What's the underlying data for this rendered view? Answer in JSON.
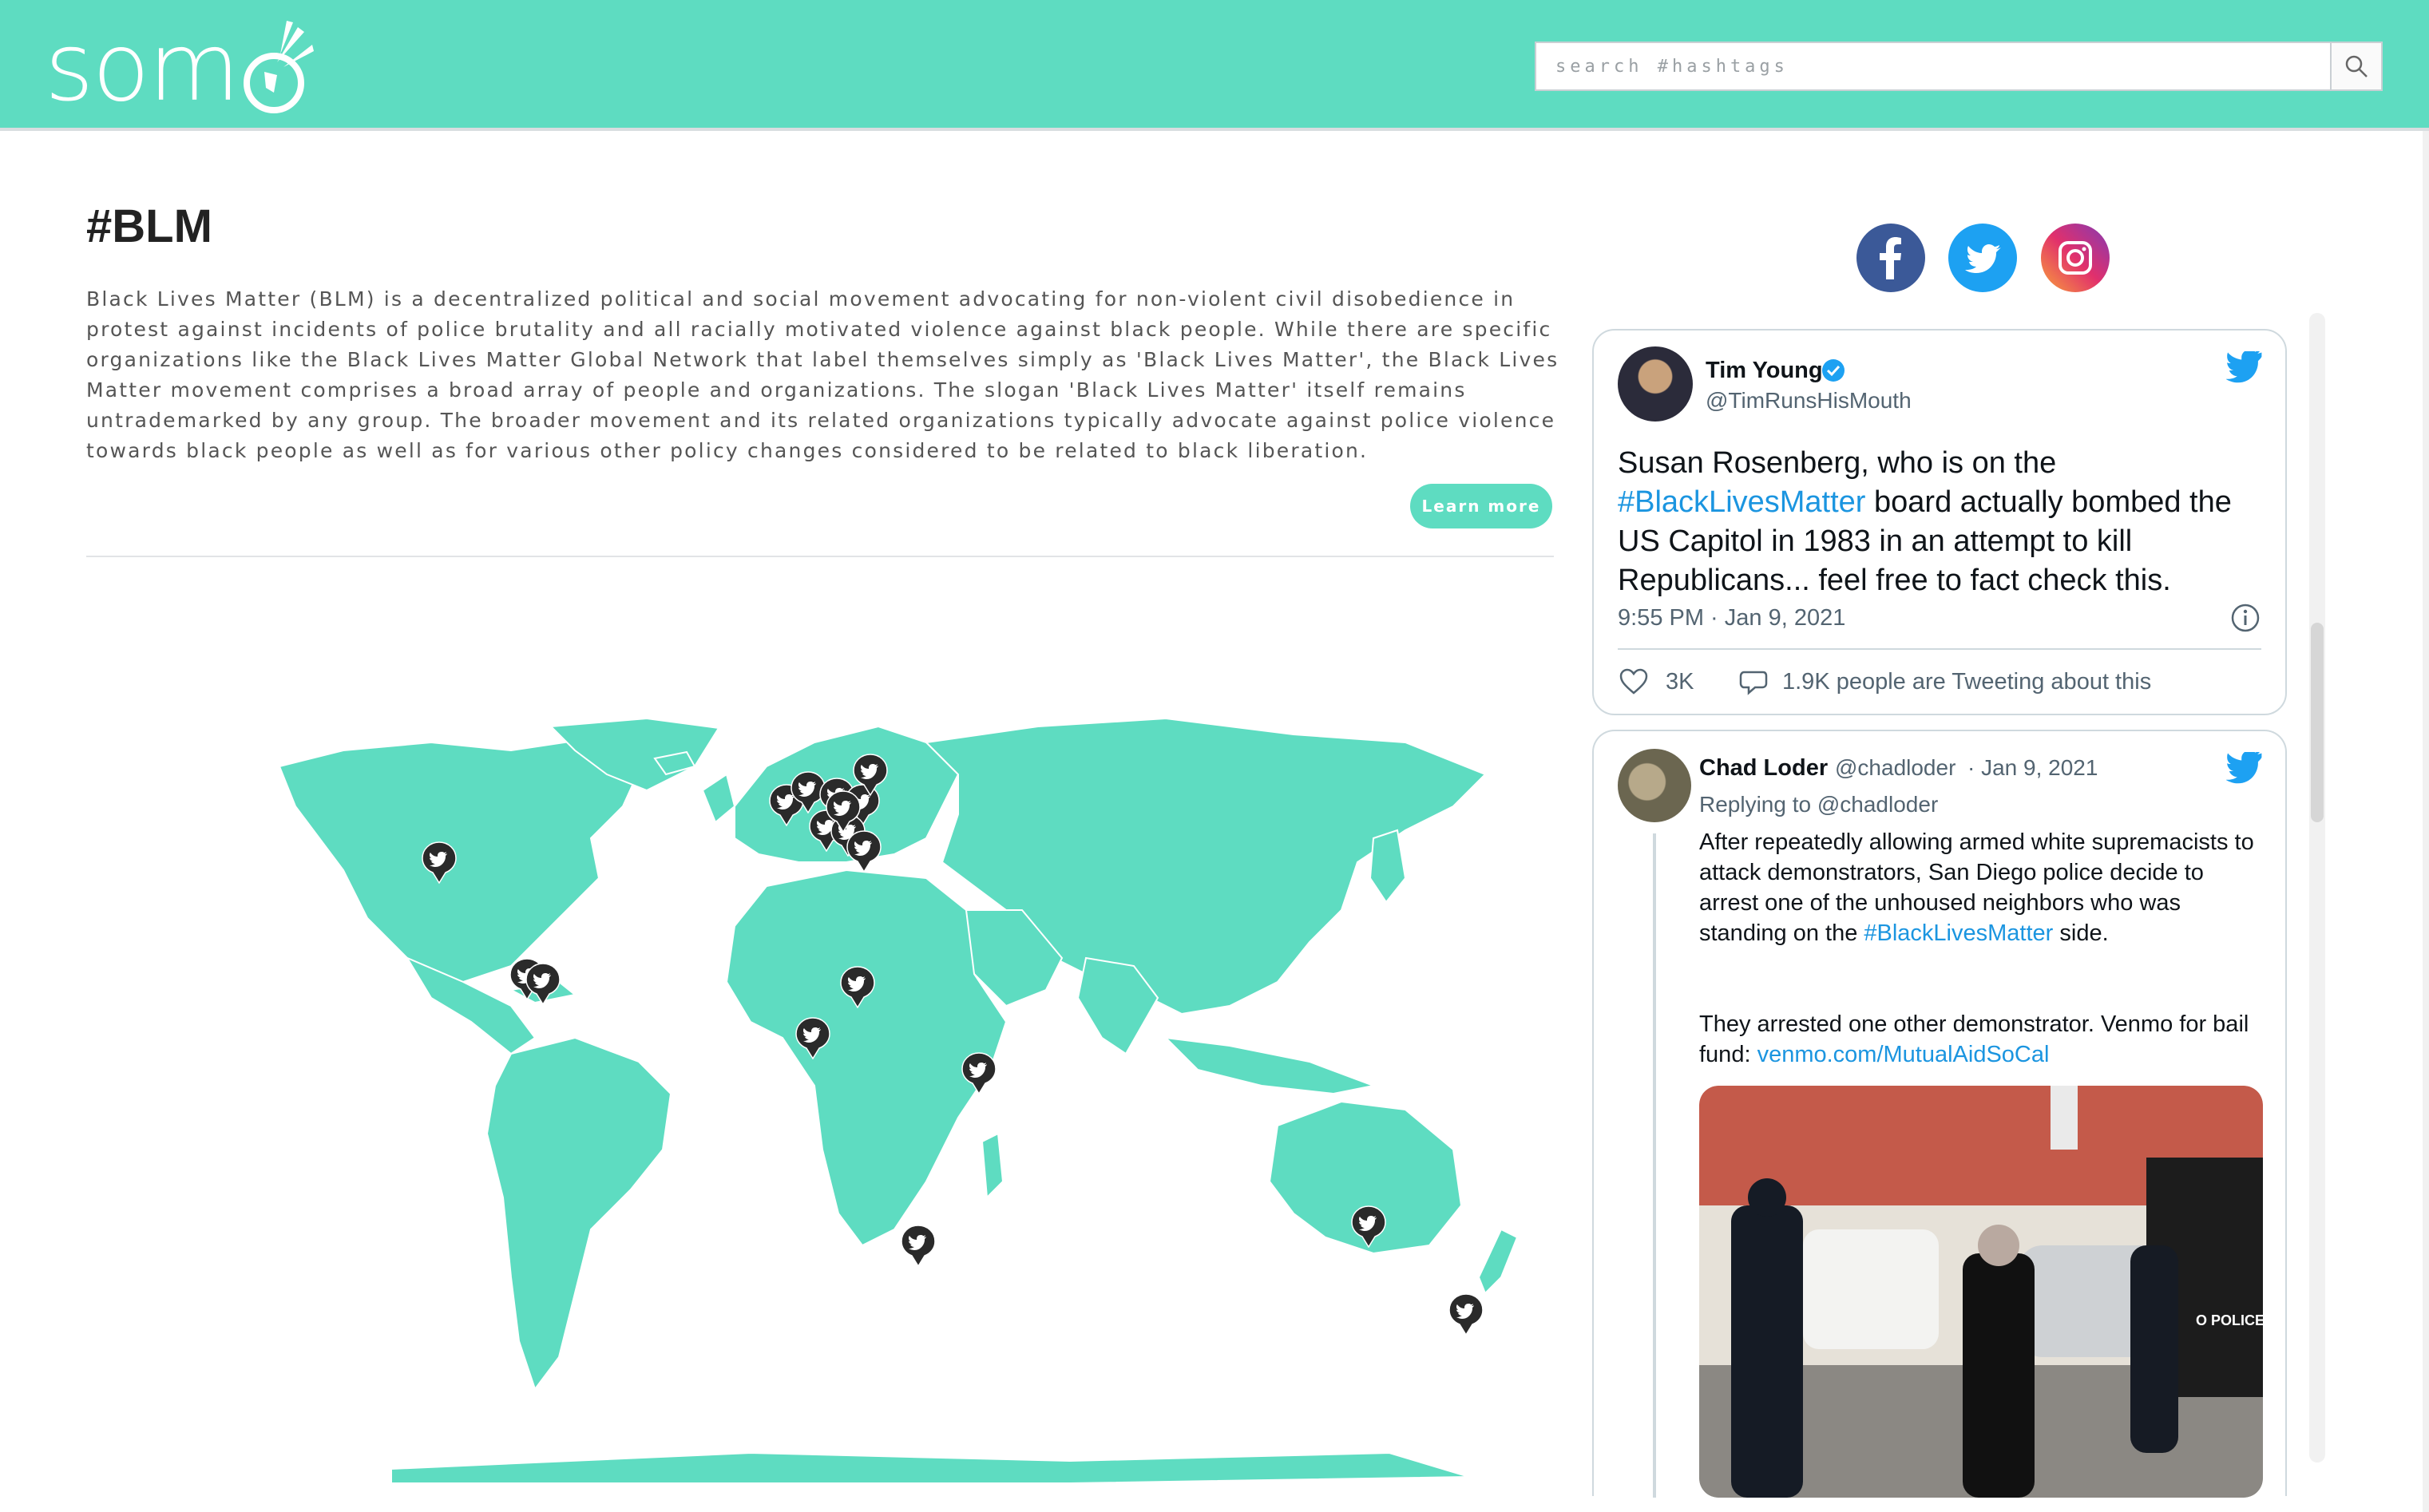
{
  "header": {
    "logo_text": "som",
    "search": {
      "placeholder": "search #hashtags"
    },
    "brand_color": "#5edcc1",
    "icons": {
      "search": "magnifier-icon"
    }
  },
  "topic": {
    "title": "#BLM",
    "description": "Black Lives Matter (BLM) is a decentralized political and social movement advocating for non-violent civil disobedience in protest against incidents of police brutality and all racially motivated violence against black people. While there are specific organizations like the Black Lives Matter Global Network that label themselves simply as 'Black Lives Matter', the Black Lives Matter movement comprises a broad array of people and organizations. The slogan 'Black Lives Matter' itself remains untrademarked by any group. The broader movement and its related organizations typically advocate against police violence towards black people as well as for various other policy changes considered to be related to black liberation.",
    "learn_more_label": "Learn more"
  },
  "map": {
    "land_color": "#5edcc1",
    "pin_icon": "twitter-pin-icon"
  },
  "social": {
    "items": [
      {
        "name": "facebook",
        "color": "#3b5998",
        "icon": "facebook-icon"
      },
      {
        "name": "twitter",
        "color": "#1da1f2",
        "icon": "twitter-icon"
      },
      {
        "name": "instagram",
        "color": "#e1306c",
        "icon": "instagram-icon"
      }
    ]
  },
  "tweets": [
    {
      "author": "Tim Young",
      "handle": "@TimRunsHisMouth",
      "verified": true,
      "text_before": "Susan Rosenberg, who is on the ",
      "hashtag": "#BlackLivesMatter",
      "text_after": "  board actually bombed the US Capitol in 1983 in an attempt to kill Republicans...  feel free to fact check this.",
      "timestamp": "9:55 PM · Jan 9, 2021",
      "likes": "3K",
      "replies_text": "1.9K people are Tweeting about this"
    },
    {
      "author": "Chad Loder",
      "handle": "@chadloder",
      "date": "· Jan 9, 2021",
      "replying_to": "Replying to @chadloder",
      "text_before": "After repeatedly allowing armed white supremacists to attack demonstrators, San Diego police decide to arrest one of the unhoused neighbors who was standing on the ",
      "hashtag": "#BlackLivesMatter",
      "text_after": " side.",
      "text_2_before": "They arrested one other demonstrator.  Venmo for bail fund: ",
      "link": "venmo.com/MutualAidSoCal",
      "photo_caption": "O POLICE"
    }
  ]
}
